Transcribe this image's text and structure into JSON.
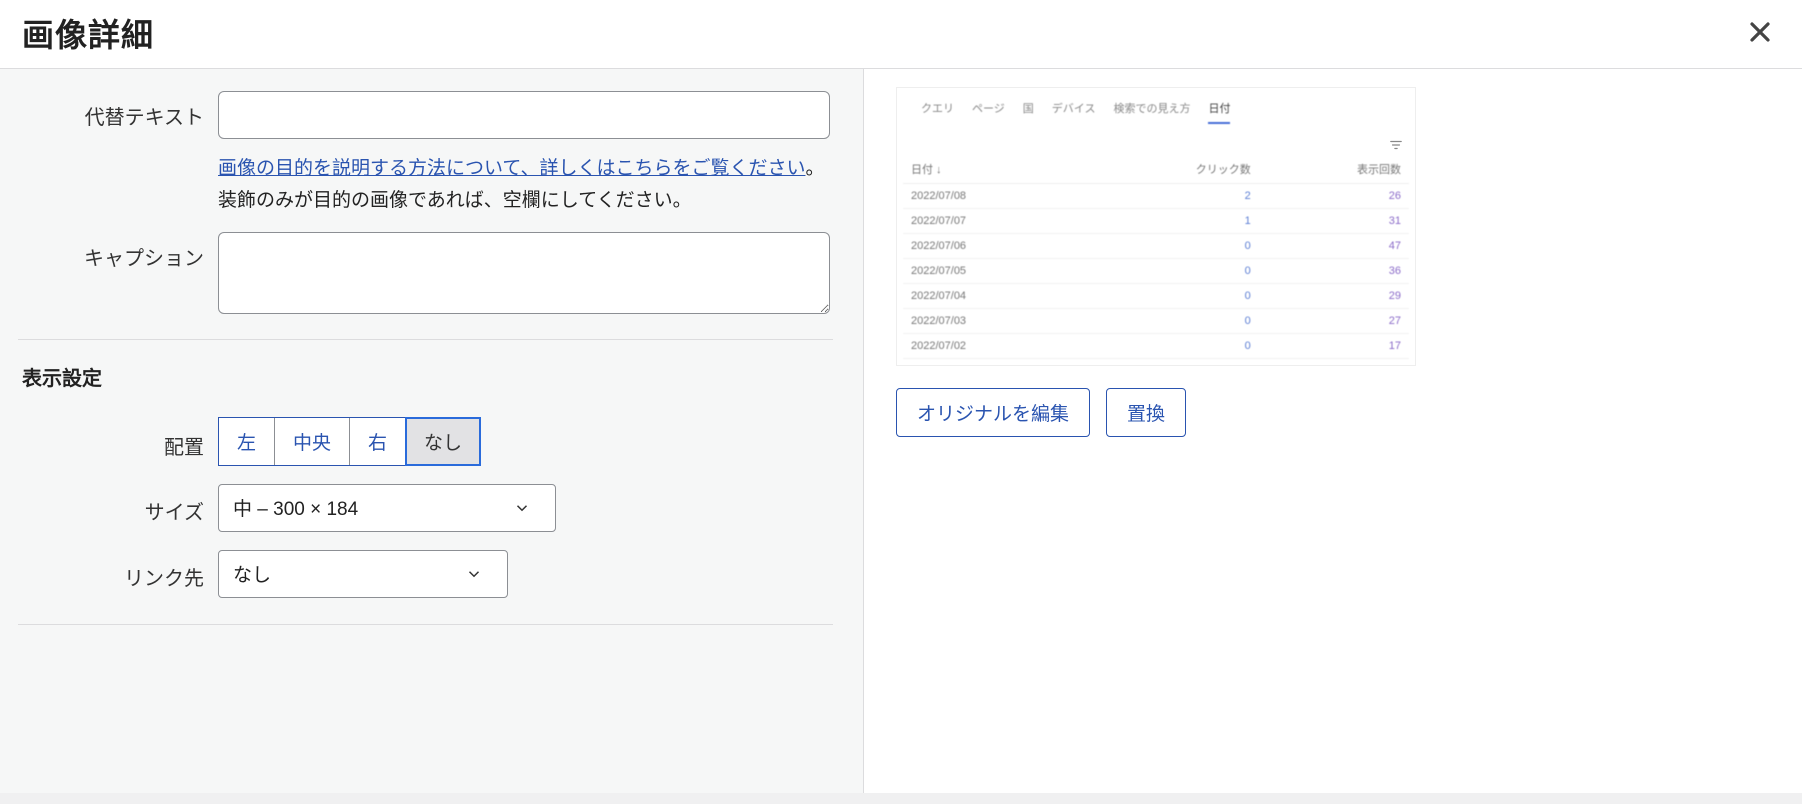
{
  "header": {
    "title": "画像詳細"
  },
  "form": {
    "altLabel": "代替テキスト",
    "altValue": "",
    "helpLink": "画像の目的を説明する方法について、詳しくはこちらをご覧ください",
    "helpTail": "。装飾のみが目的の画像であれば、空欄にしてください。",
    "captionLabel": "キャプション",
    "captionValue": ""
  },
  "display": {
    "sectionTitle": "表示設定",
    "alignLabel": "配置",
    "alignOptions": {
      "left": "左",
      "center": "中央",
      "right": "右",
      "none": "なし"
    },
    "alignSelected": "none",
    "sizeLabel": "サイズ",
    "sizeValue": "中 – 300 × 184",
    "linkLabel": "リンク先",
    "linkValue": "なし"
  },
  "preview": {
    "tabs": [
      "クエリ",
      "ページ",
      "国",
      "デバイス",
      "検索での見え方",
      "日付"
    ],
    "activeTab": 5,
    "cols": {
      "date": "日付 ↓",
      "clicks": "クリック数",
      "impressions": "表示回数"
    },
    "rows": [
      {
        "date": "2022/07/08",
        "clicks": "2",
        "imp": "26"
      },
      {
        "date": "2022/07/07",
        "clicks": "1",
        "imp": "31"
      },
      {
        "date": "2022/07/06",
        "clicks": "0",
        "imp": "47"
      },
      {
        "date": "2022/07/05",
        "clicks": "0",
        "imp": "36"
      },
      {
        "date": "2022/07/04",
        "clicks": "0",
        "imp": "29"
      },
      {
        "date": "2022/07/03",
        "clicks": "0",
        "imp": "27"
      },
      {
        "date": "2022/07/02",
        "clicks": "0",
        "imp": "17"
      }
    ]
  },
  "actions": {
    "editOriginal": "オリジナルを編集",
    "replace": "置換"
  }
}
